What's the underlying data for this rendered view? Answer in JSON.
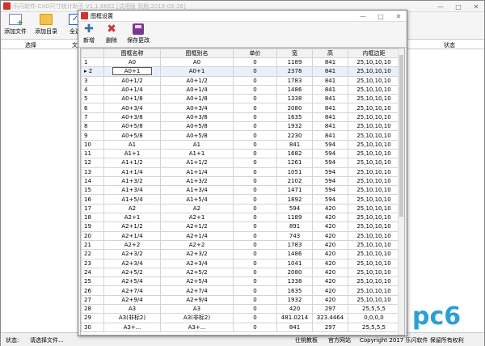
{
  "main": {
    "title": "乐闪软件-CAD尺寸统计助手 V1.1.6662 [试用版 到期:2019-05-26]",
    "toolbar": [
      {
        "label": "添加文件"
      },
      {
        "label": "添加目录"
      },
      {
        "label": "全选"
      }
    ],
    "header": {
      "col_select": "选择",
      "col_file": "文",
      "col_status": "状态"
    },
    "status": {
      "label": "状态:",
      "value": "请选择文件...",
      "qq_group": "仕桃教板",
      "site": "官方网站",
      "copyright": "Copyright 2017 乐闪软件 保留所有权利"
    }
  },
  "dialog": {
    "title": "图框设置",
    "toolbar": {
      "add": "新增",
      "delete": "删除",
      "save": "保存更改"
    },
    "columns": [
      "图框名称",
      "图框别名",
      "单价",
      "宽",
      "高",
      "内框边距"
    ],
    "rows": [
      [
        "1",
        "A0",
        "A0",
        "0",
        "1189",
        "841",
        "25,10,10,10"
      ],
      [
        "2",
        "A0+1",
        "A0+1",
        "0",
        "2378",
        "841",
        "25,10,10,10"
      ],
      [
        "3",
        "A0+1/2",
        "A0+1/2",
        "0",
        "1783",
        "841",
        "25,10,10,10"
      ],
      [
        "4",
        "A0+1/4",
        "A0+1/4",
        "0",
        "1486",
        "841",
        "25,10,10,10"
      ],
      [
        "5",
        "A0+1/8",
        "A0+1/8",
        "0",
        "1338",
        "841",
        "25,10,10,10"
      ],
      [
        "6",
        "A0+3/4",
        "A0+3/4",
        "0",
        "2080",
        "841",
        "25,10,10,10"
      ],
      [
        "7",
        "A0+3/8",
        "A0+3/8",
        "0",
        "1635",
        "841",
        "25,10,10,10"
      ],
      [
        "8",
        "A0+5/8",
        "A0+5/8",
        "0",
        "1932",
        "841",
        "25,10,10,10"
      ],
      [
        "9",
        "A0+5/8",
        "A0+5/8",
        "0",
        "2230",
        "841",
        "25,10,10,10"
      ],
      [
        "10",
        "A1",
        "A1",
        "0",
        "841",
        "594",
        "25,10,10,10"
      ],
      [
        "11",
        "A1+1",
        "A1+1",
        "0",
        "1682",
        "594",
        "25,10,10,10"
      ],
      [
        "12",
        "A1+1/2",
        "A1+1/2",
        "0",
        "1261",
        "594",
        "25,10,10,10"
      ],
      [
        "13",
        "A1+1/4",
        "A1+1/4",
        "0",
        "1051",
        "594",
        "25,10,10,10"
      ],
      [
        "14",
        "A1+3/2",
        "A1+3/2",
        "0",
        "2102",
        "594",
        "25,10,10,10"
      ],
      [
        "15",
        "A1+3/4",
        "A1+3/4",
        "0",
        "1471",
        "594",
        "25,10,10,10"
      ],
      [
        "16",
        "A1+5/4",
        "A1+5/4",
        "0",
        "1892",
        "594",
        "25,10,10,10"
      ],
      [
        "17",
        "A2",
        "A2",
        "0",
        "594",
        "420",
        "25,10,10,10"
      ],
      [
        "18",
        "A2+1",
        "A2+1",
        "0",
        "1189",
        "420",
        "25,10,10,10"
      ],
      [
        "19",
        "A2+1/2",
        "A2+1/2",
        "0",
        "891",
        "420",
        "25,10,10,10"
      ],
      [
        "20",
        "A2+1/4",
        "A2+1/4",
        "0",
        "743",
        "420",
        "25,10,10,10"
      ],
      [
        "21",
        "A2+2",
        "A2+2",
        "0",
        "1783",
        "420",
        "25,10,10,10"
      ],
      [
        "22",
        "A2+3/2",
        "A2+3/2",
        "0",
        "1486",
        "420",
        "25,10,10,10"
      ],
      [
        "23",
        "A2+3/4",
        "A2+3/4",
        "0",
        "1041",
        "420",
        "25,10,10,10"
      ],
      [
        "24",
        "A2+5/2",
        "A2+5/2",
        "0",
        "2080",
        "420",
        "25,10,10,10"
      ],
      [
        "25",
        "A2+5/4",
        "A2+5/4",
        "0",
        "1338",
        "420",
        "25,10,10,10"
      ],
      [
        "26",
        "A2+7/4",
        "A2+7/4",
        "0",
        "1635",
        "420",
        "25,10,10,10"
      ],
      [
        "27",
        "A2+9/4",
        "A2+9/4",
        "0",
        "1932",
        "420",
        "25,10,10,10"
      ],
      [
        "28",
        "A3",
        "A3",
        "0",
        "420",
        "297",
        "25,5,5,5"
      ],
      [
        "29",
        "A3(非标2)",
        "A3(非标2)",
        "0",
        "481.0214",
        "323.4464",
        "0,0,0,0"
      ],
      [
        "30",
        "A3+...",
        "A3+...",
        "0",
        "841",
        "297",
        "25,5,5,5"
      ]
    ],
    "selected_row": "2"
  },
  "watermark": {
    "text": "pc6"
  }
}
